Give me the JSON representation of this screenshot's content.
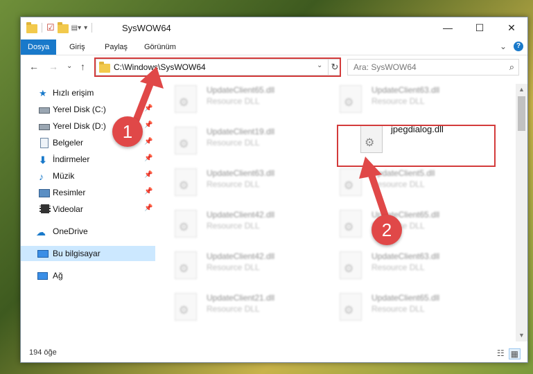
{
  "window": {
    "title": "SysWOW64"
  },
  "window_controls": {
    "minimize": "—",
    "maximize": "☐",
    "close": "✕"
  },
  "ribbon": {
    "tabs": [
      "Dosya",
      "Giriş",
      "Paylaş",
      "Görünüm"
    ],
    "expand": "⌄",
    "help": "?"
  },
  "nav": {
    "back": "←",
    "forward": "→",
    "recent": "⌄",
    "up": "↑"
  },
  "address": {
    "path": "C:\\Windows\\SysWOW64",
    "dropdown": "⌄",
    "refresh": "↻"
  },
  "search": {
    "placeholder": "Ara: SysWOW64",
    "icon": "⌕"
  },
  "sidebar": {
    "items": [
      {
        "label": "Hızlı erişim",
        "icon": "star-icon",
        "pinned": false
      },
      {
        "label": "Yerel Disk (C:)",
        "icon": "drive-icon",
        "pinned": true
      },
      {
        "label": "Yerel Disk (D:)",
        "icon": "drive-icon",
        "pinned": true
      },
      {
        "label": "Belgeler",
        "icon": "documents-icon",
        "pinned": true
      },
      {
        "label": "İndirmeler",
        "icon": "download-icon",
        "pinned": true
      },
      {
        "label": "Müzik",
        "icon": "music-icon",
        "pinned": true
      },
      {
        "label": "Resimler",
        "icon": "pictures-icon",
        "pinned": true
      },
      {
        "label": "Videolar",
        "icon": "videos-icon",
        "pinned": true
      },
      {
        "label": "OneDrive",
        "icon": "cloud-icon",
        "pinned": false
      },
      {
        "label": "Bu bilgisayar",
        "icon": "computer-icon",
        "pinned": false,
        "selected": true
      },
      {
        "label": "Ağ",
        "icon": "network-icon",
        "pinned": false
      }
    ]
  },
  "files": [
    {
      "name": "UpdateClient65.dll",
      "desc": "Resource DLL"
    },
    {
      "name": "UpdateClient63.dll",
      "desc": "Resource DLL"
    },
    {
      "name": "UpdateClient19.dll",
      "desc": "Resource DLL"
    },
    {
      "name": "jpegdialog.dll",
      "desc": "",
      "highlighted": true
    },
    {
      "name": "UpdateClient63.dll",
      "desc": "Resource DLL"
    },
    {
      "name": "UpdateClient5.dll",
      "desc": "Resource DLL"
    },
    {
      "name": "UpdateClient42.dll",
      "desc": "Resource DLL"
    },
    {
      "name": "UpdateClient65.dll",
      "desc": "Resource DLL"
    },
    {
      "name": "UpdateClient42.dll",
      "desc": "Resource DLL"
    },
    {
      "name": "UpdateClient63.dll",
      "desc": "Resource DLL"
    },
    {
      "name": "UpdateClient21.dll",
      "desc": "Resource DLL"
    },
    {
      "name": "UpdateClient65.dll",
      "desc": "Resource DLL"
    }
  ],
  "status": {
    "count": "194 öğe"
  },
  "annotations": {
    "step1": "1",
    "step2": "2",
    "color": "#e04848"
  }
}
